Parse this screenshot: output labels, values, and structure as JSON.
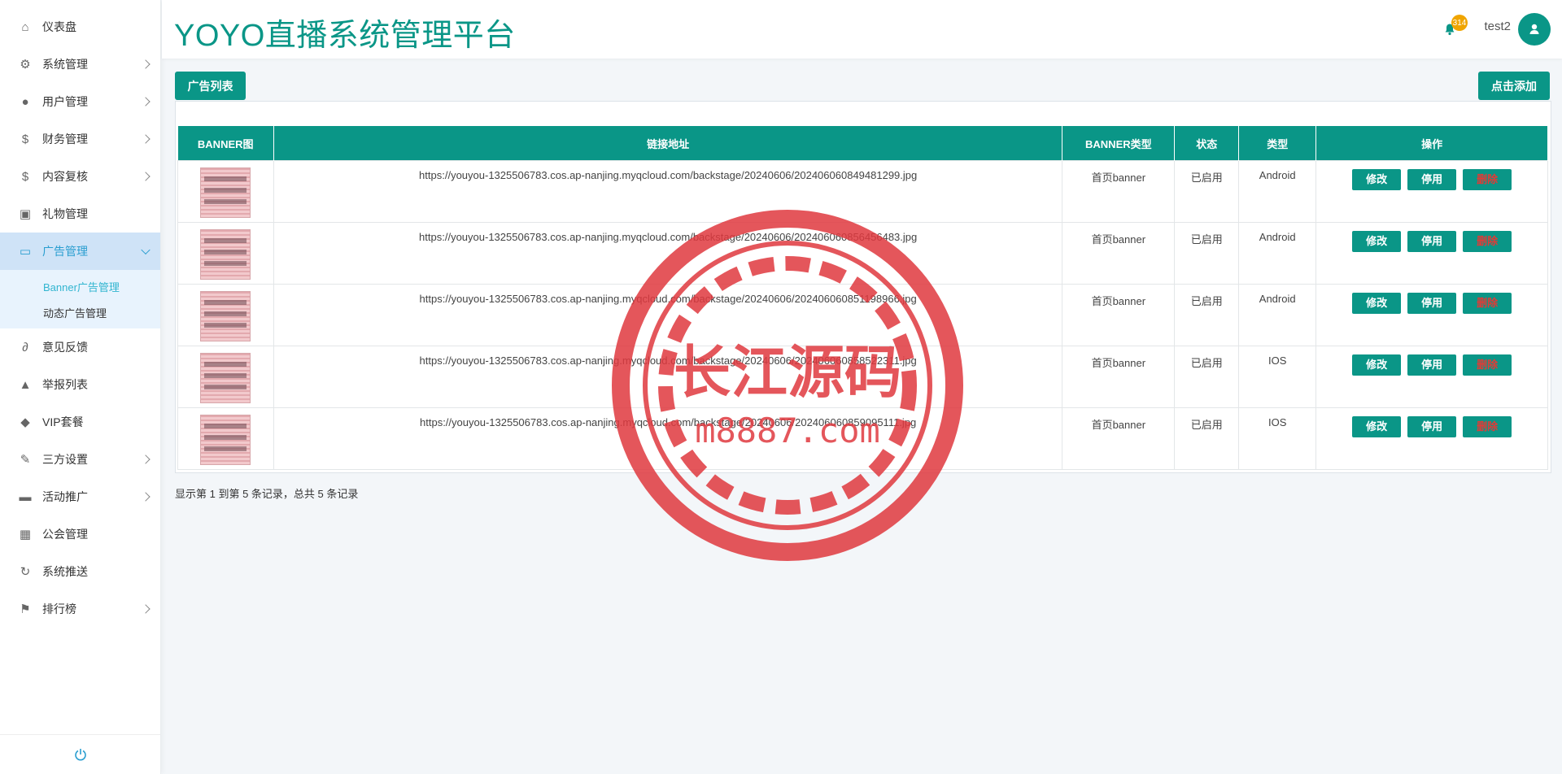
{
  "app": {
    "title": "YOYO直播系统管理平台"
  },
  "header": {
    "notification_count": "314",
    "username": "test2"
  },
  "sidebar": {
    "items": [
      {
        "label": "仪表盘",
        "icon": "home-icon",
        "has_children": false
      },
      {
        "label": "系统管理",
        "icon": "cogs-icon",
        "has_children": true
      },
      {
        "label": "用户管理",
        "icon": "user-icon",
        "has_children": true
      },
      {
        "label": "财务管理",
        "icon": "dollar-icon",
        "has_children": true
      },
      {
        "label": "内容复核",
        "icon": "dollar-icon",
        "has_children": true
      },
      {
        "label": "礼物管理",
        "icon": "gift-icon",
        "has_children": false
      },
      {
        "label": "广告管理",
        "icon": "monitor-icon",
        "has_children": true,
        "active": true,
        "children": [
          {
            "label": "Banner广告管理",
            "active": true
          },
          {
            "label": "动态广告管理"
          }
        ]
      },
      {
        "label": "意见反馈",
        "icon": "paperclip-icon",
        "has_children": false
      },
      {
        "label": "举报列表",
        "icon": "warning-icon",
        "has_children": false
      },
      {
        "label": "VIP套餐",
        "icon": "piggy-bank-icon",
        "has_children": false
      },
      {
        "label": "三方设置",
        "icon": "wrench-icon",
        "has_children": true
      },
      {
        "label": "活动推广",
        "icon": "briefcase-icon",
        "has_children": true
      },
      {
        "label": "公会管理",
        "icon": "grid-icon",
        "has_children": false
      },
      {
        "label": "系统推送",
        "icon": "refresh-icon",
        "has_children": false
      },
      {
        "label": "排行榜",
        "icon": "flag-icon",
        "has_children": true
      }
    ]
  },
  "toolbar": {
    "tab_label": "广告列表",
    "add_label": "点击添加"
  },
  "table": {
    "headers": [
      "BANNER图",
      "链接地址",
      "BANNER类型",
      "状态",
      "类型",
      "操作"
    ],
    "rows": [
      {
        "url": "https://youyou-1325506783.cos.ap-nanjing.myqcloud.com/backstage/20240606/202406060849481299.jpg",
        "banner_type": "首页banner",
        "status": "已启用",
        "type": "Android"
      },
      {
        "url": "https://youyou-1325506783.cos.ap-nanjing.myqcloud.com/backstage/20240606/202406060856456483.jpg",
        "banner_type": "首页banner",
        "status": "已启用",
        "type": "Android"
      },
      {
        "url": "https://youyou-1325506783.cos.ap-nanjing.myqcloud.com/backstage/20240606/202406060851198966.jpg",
        "banner_type": "首页banner",
        "status": "已启用",
        "type": "Android"
      },
      {
        "url": "https://youyou-1325506783.cos.ap-nanjing.myqcloud.com/backstage/20240606/202406060858522311.jpg",
        "banner_type": "首页banner",
        "status": "已启用",
        "type": "IOS"
      },
      {
        "url": "https://youyou-1325506783.cos.ap-nanjing.myqcloud.com/backstage/20240606/202406060859095111.jpg",
        "banner_type": "首页banner",
        "status": "已启用",
        "type": "IOS"
      }
    ],
    "actions": {
      "edit": "修改",
      "disable": "停用",
      "delete": "删除"
    }
  },
  "pagination": {
    "info": "显示第 1 到第 5 条记录，总共 5 条记录"
  },
  "watermark": {
    "text": "长江源码",
    "subtext": "m8887.com"
  },
  "colors": {
    "primary": "#0a9687",
    "active_nav_bg": "#cfe3f7",
    "active_sub": "#31b5d0",
    "delete_text": "#e53935",
    "badge": "#f0a500",
    "watermark": "#e0393f"
  }
}
